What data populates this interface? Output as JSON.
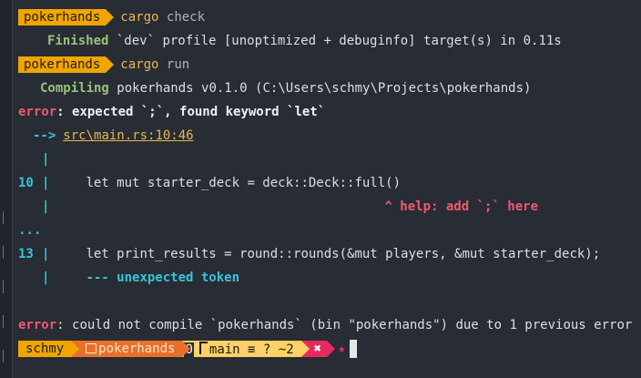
{
  "prompt": {
    "dir_segment": "pokerhands"
  },
  "history": [
    {
      "command": "cargo",
      "args": "check"
    },
    {
      "command": "cargo",
      "args": "run"
    }
  ],
  "output": {
    "finished_label": "Finished",
    "finished_text": "`dev` profile [unoptimized + debuginfo] target(s) in 0.11s",
    "compiling_label": "Compiling",
    "compiling_text": "pokerhands v0.1.0 (C:\\Users\\schmy\\Projects\\pokerhands)",
    "error_word": "error",
    "error_message": ": expected `;`, found keyword `let`",
    "arrow": "-->",
    "location": "src\\main.rs:10:46",
    "pipe": "|",
    "line10_no": "10",
    "line10_code": "let mut starter_deck = deck::Deck::full()",
    "help_text": "^ help: add `;` here",
    "ellipsis": "...",
    "line13_no": "13",
    "line13_code": "let print_results = round::rounds(&mut players, &mut starter_deck);",
    "unexpected_text": "--- unexpected token",
    "final_error_word": "error",
    "final_error_text": ": could not compile `pokerhands` (bin \"pokerhands\") due to 1 previous error"
  },
  "status_prompt": {
    "user": "schmy",
    "dir": "pokerhands",
    "zero": "0",
    "branch": "main",
    "git_info": "≡ ? ~2",
    "status_icon": "✖",
    "star": "★"
  },
  "colors": {
    "background": "#282c34",
    "prompt_orange": "#f0a500",
    "dir_orange": "#e8702a",
    "git_yellow": "#ffd166",
    "error_pink": "#e7295f",
    "cyan": "#39c3d9",
    "green": "#98c379",
    "red": "#ef5a6f"
  }
}
